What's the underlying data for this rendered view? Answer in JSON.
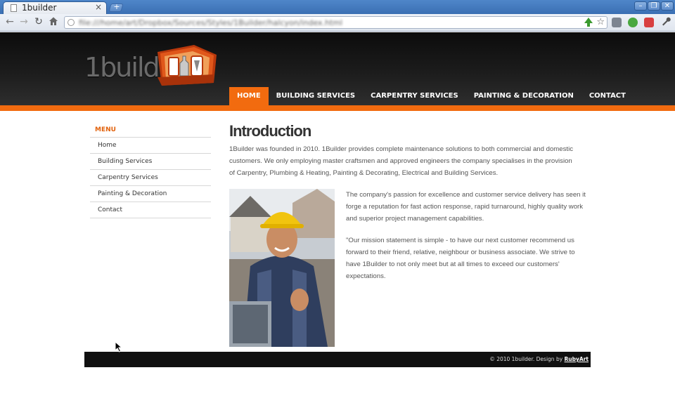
{
  "browser": {
    "tab_title": "1builder",
    "tab_close": "×",
    "new_tab": "+",
    "url": "file:///home/art/Dropbox/Sources/Styles/1Builder/halcyon/index.html",
    "window_buttons": [
      "–",
      "❐",
      "✕"
    ],
    "nav_icons": [
      "back-icon",
      "forward-icon",
      "reload-icon",
      "home-icon"
    ]
  },
  "site": {
    "logo_text": "1builder",
    "nav": [
      {
        "label": "HOME",
        "active": true
      },
      {
        "label": "BUILDING SERVICES",
        "active": false
      },
      {
        "label": "CARPENTRY SERVICES",
        "active": false
      },
      {
        "label": "PAINTING & DECORATION",
        "active": false
      },
      {
        "label": "CONTACT",
        "active": false
      }
    ],
    "accent_color": "#f26b0f"
  },
  "sidebar": {
    "title": "MENU",
    "items": [
      "Home",
      "Building Services",
      "Carpentry Services",
      "Painting & Decoration",
      "Contact"
    ]
  },
  "content": {
    "title": "Introduction",
    "intro": "1Builder was founded in 2010. 1Builder provides complete maintenance solutions to both commercial and domestic customers. We only employing master craftsmen and approved engineers the company specialises in the provision of Carpentry, Plumbing & Heating, Painting & Decorating, Electrical and Building Services.",
    "para1": "The company's passion for excellence and customer service delivery has seen it forge a reputation for fast action response, rapid turnaround, highly quality work and superior project management capabilities.",
    "para2": "\"Our mission statement is simple - to have our next customer recommend us forward to their friend, relative, neighbour or business associate. We strive to have 1Builder to not only meet but at all times to exceed our customers' expectations."
  },
  "footer": {
    "text": "© 2010 1builder. Design by",
    "link": "RubyArt"
  }
}
